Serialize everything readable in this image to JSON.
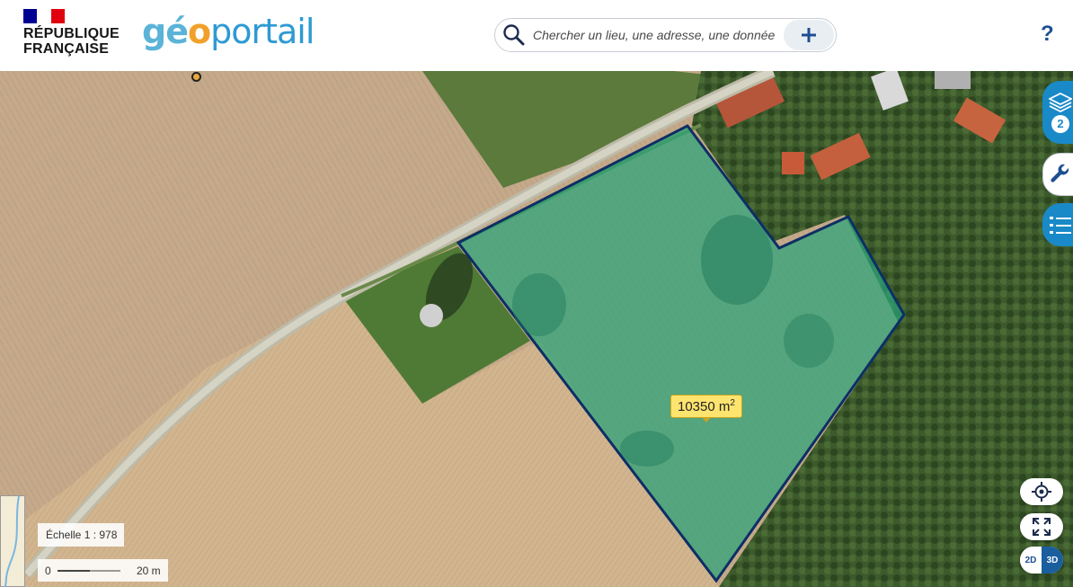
{
  "header": {
    "gov_line1": "RÉPUBLIQUE",
    "gov_line2": "FRANÇAISE",
    "logo_geo_g": "g",
    "logo_geo_e": "é",
    "logo_geo_o": "o",
    "logo_portail": "portail",
    "search_placeholder": "Chercher un lieu, une adresse, une donnée",
    "help_label": "?"
  },
  "map": {
    "area_value": "10350 m",
    "area_unit_exponent": "2",
    "layers_count": "2",
    "scale_label": "Échelle 1 : 978",
    "scale_zero": "0",
    "scale_distance": "20 m",
    "mode_2d": "2D",
    "mode_3d": "3D"
  },
  "icons": {
    "search": "search-icon",
    "add": "plus-icon",
    "layers": "layers-icon",
    "tools": "wrench-icon",
    "legend": "list-icon",
    "locate": "locate-icon",
    "fullscreen": "fullscreen-icon"
  },
  "colors": {
    "brand_blue": "#1a89c8",
    "parcel_fill": "#2aa37a",
    "parcel_outline": "#0d2f66",
    "label_bg": "#fde46f"
  }
}
